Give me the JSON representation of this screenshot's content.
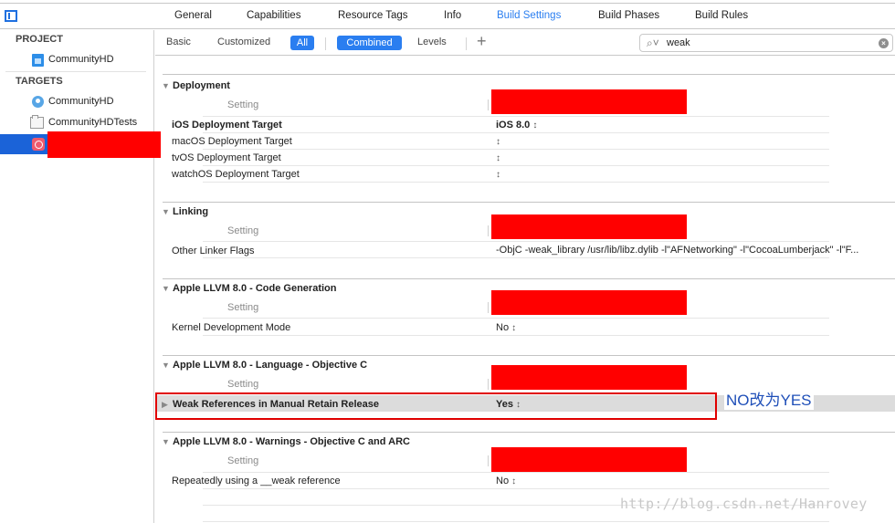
{
  "top_tabs": [
    {
      "label": "General",
      "active": false
    },
    {
      "label": "Capabilities",
      "active": false
    },
    {
      "label": "Resource Tags",
      "active": false
    },
    {
      "label": "Info",
      "active": false
    },
    {
      "label": "Build Settings",
      "active": true
    },
    {
      "label": "Build Phases",
      "active": false
    },
    {
      "label": "Build Rules",
      "active": false
    }
  ],
  "sidebar": {
    "project_header": "PROJECT",
    "project_items": [
      {
        "label": "CommunityHD",
        "icon": "project-file-icon"
      }
    ],
    "targets_header": "TARGETS",
    "target_items": [
      {
        "label": "CommunityHD",
        "icon": "app-target-icon"
      },
      {
        "label": "CommunityHDTests",
        "icon": "test-bundle-icon"
      },
      {
        "label": "",
        "icon": "app-icon",
        "selected": true,
        "redacted": true
      }
    ]
  },
  "filter_bar": {
    "basic": "Basic",
    "customized": "Customized",
    "all": "All",
    "combined": "Combined",
    "levels": "Levels",
    "add": "+",
    "search_icon": "⌕˅",
    "search_value": "weak",
    "clear": "×"
  },
  "groups": [
    {
      "title": "Deployment",
      "column_header": "Setting",
      "rows": [
        {
          "name": "iOS Deployment Target",
          "value": "iOS 8.0",
          "bold": true
        },
        {
          "name": "macOS Deployment Target",
          "value": ""
        },
        {
          "name": "tvOS Deployment Target",
          "value": ""
        },
        {
          "name": "watchOS Deployment Target",
          "value": ""
        }
      ]
    },
    {
      "title": "Linking",
      "column_header": "Setting",
      "rows": [
        {
          "name": "Other Linker Flags",
          "value": "-ObjC -weak_library /usr/lib/libz.dylib -l\"AFNetworking\" -l\"CocoaLumberjack\" -l\"F..."
        }
      ]
    },
    {
      "title": "Apple LLVM 8.0 - Code Generation",
      "column_header": "Setting",
      "rows": [
        {
          "name": "Kernel Development Mode",
          "value": "No"
        }
      ]
    },
    {
      "title": "Apple LLVM 8.0 - Language - Objective C",
      "column_header": "Setting",
      "rows": [
        {
          "name": "Weak References in Manual Retain Release",
          "value": "Yes",
          "bold": true,
          "highlighted": true
        }
      ]
    },
    {
      "title": "Apple LLVM 8.0 - Warnings - Objective C and ARC",
      "column_header": "Setting",
      "rows": [
        {
          "name": "Repeatedly using a __weak reference",
          "value": "No"
        }
      ]
    }
  ],
  "stepper_glyph": "↕",
  "annotation": "NO改为YES",
  "watermark": "http://blog.csdn.net/Hanrovey",
  "colors": {
    "accent": "#2a7ef0",
    "selection": "#1b63d8",
    "redaction": "#ff0000",
    "annotation": "#1f4fb8"
  }
}
